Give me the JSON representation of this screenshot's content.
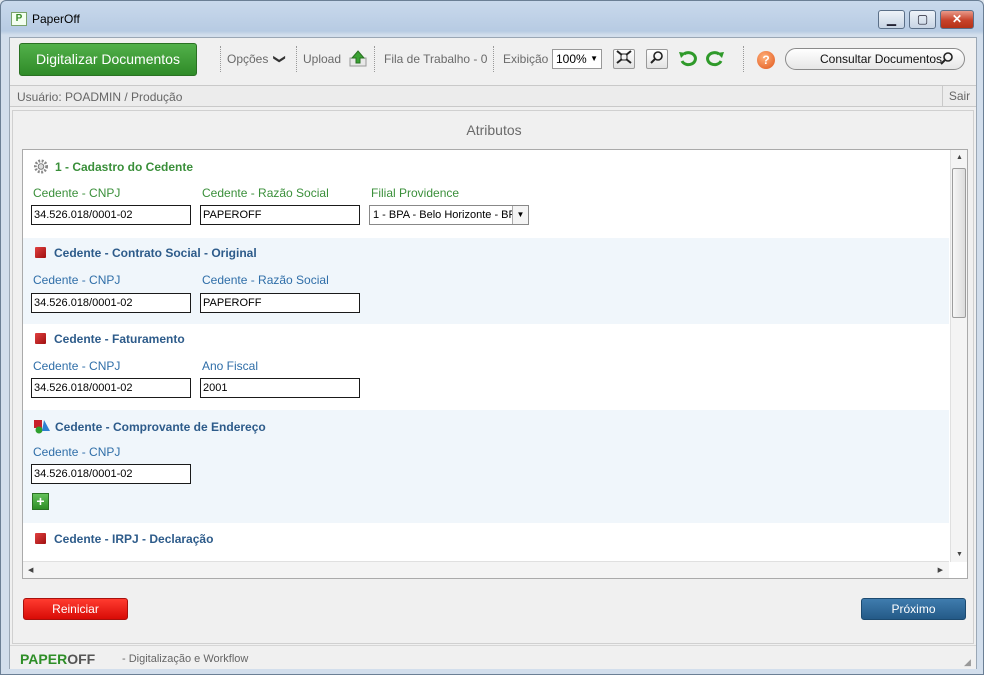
{
  "window": {
    "title": "PaperOff",
    "min": "▁",
    "max": "▢",
    "close": "✕",
    "app_icon": "P"
  },
  "toolbar": {
    "digitalize": "Digitalizar Documentos",
    "options": "Opções",
    "options_arrow": "❯",
    "upload": "Upload",
    "queue": "Fila de Trabalho - 0",
    "view": "Exibição",
    "zoom": "100%",
    "help": "?",
    "consult": "Consultar Documentos",
    "icons": {
      "upload": "upload-icon",
      "fit": "fit-screen-icon",
      "zoom": "magnifier-icon",
      "rotate_left": "rotate-left-icon",
      "rotate_right": "rotate-right-icon"
    }
  },
  "userbar": {
    "user": "Usuário: POADMIN / Produção",
    "logout": "Sair"
  },
  "main": {
    "title": "Atributos",
    "sections": [
      {
        "title": "1 - Cadastro do Cedente",
        "fields": [
          {
            "label": "Cedente - CNPJ",
            "value": "34.526.018/0001-02"
          },
          {
            "label": "Cedente - Razão Social",
            "value": "PAPEROFF"
          },
          {
            "label": "Filial Providence",
            "value": "1 - BPA - Belo Horizonte - BP"
          }
        ]
      },
      {
        "title": "Cedente - Contrato Social - Original",
        "fields": [
          {
            "label": "Cedente - CNPJ",
            "value": "34.526.018/0001-02"
          },
          {
            "label": "Cedente - Razão Social",
            "value": "PAPEROFF"
          }
        ]
      },
      {
        "title": "Cedente - Faturamento",
        "fields": [
          {
            "label": "Cedente - CNPJ",
            "value": "34.526.018/0001-02"
          },
          {
            "label": "Ano Fiscal",
            "value": "2001"
          }
        ]
      },
      {
        "title": "Cedente - Comprovante de Endereço",
        "fields": [
          {
            "label": "Cedente - CNPJ",
            "value": "34.526.018/0001-02"
          }
        ],
        "add": "+"
      },
      {
        "title": "Cedente - IRPJ - Declaração",
        "fields": []
      }
    ],
    "reset": "Reiniciar",
    "next": "Próximo"
  },
  "footer": {
    "brand_a": "PAPER",
    "brand_b": "OFF",
    "tagline": "- Digitalização e Workflow"
  }
}
